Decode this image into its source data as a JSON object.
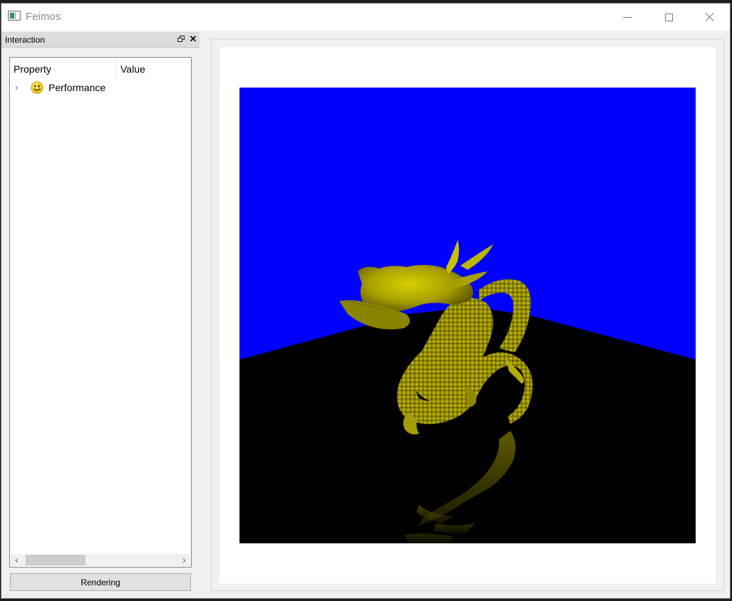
{
  "window": {
    "title": "Feimos"
  },
  "dock": {
    "title": "Interaction"
  },
  "tree": {
    "columns": [
      "Property",
      "Value"
    ],
    "rows": [
      {
        "label": "Performance",
        "icon": "smiley-icon",
        "expanded": false
      }
    ]
  },
  "actions": {
    "render_label": "Rendering"
  },
  "render": {
    "background_color": "#0000ff",
    "floor_color": "#000000",
    "model_color": "#c8c000"
  }
}
